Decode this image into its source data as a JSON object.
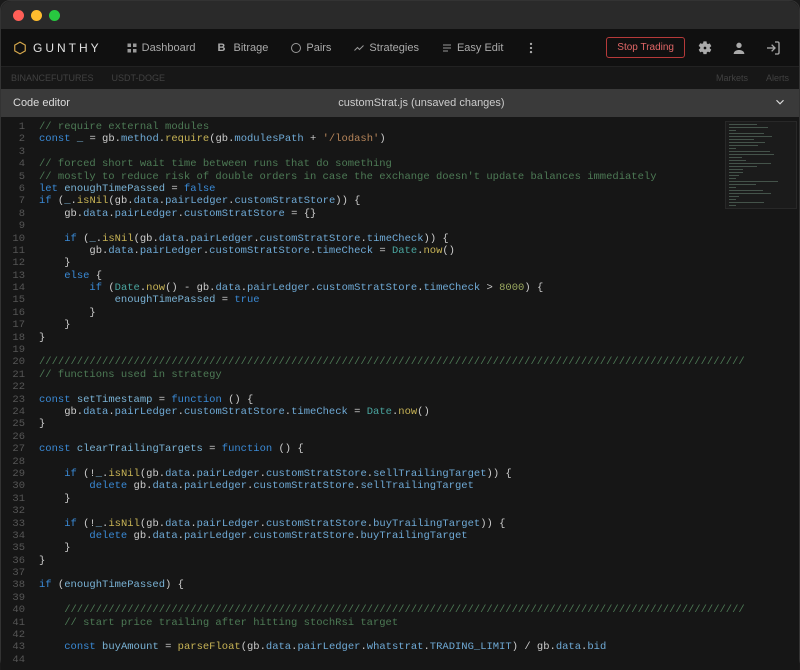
{
  "brand": "GUNTHY",
  "nav": {
    "dashboard": "Dashboard",
    "bitrage": "Bitrage",
    "pairs": "Pairs",
    "strategies": "Strategies",
    "easyedit": "Easy Edit"
  },
  "subbar": {
    "exchange": "BINANCEFUTURES",
    "pair": "USDT-DOGE",
    "markets": "Markets",
    "alerts": "Alerts"
  },
  "actions": {
    "stop": "Stop Trading"
  },
  "editor": {
    "title": "Code editor",
    "filename": "customStrat.js (unsaved changes)"
  },
  "code": {
    "lines": [
      {
        "n": 1,
        "t": "comment",
        "raw": "// require external modules"
      },
      {
        "n": 2,
        "t": "code",
        "raw": "const _ = gb.method.require(gb.modulesPath + '/lodash')"
      },
      {
        "n": 3,
        "t": "blank",
        "raw": ""
      },
      {
        "n": 4,
        "t": "comment",
        "raw": "// forced short wait time between runs that do something"
      },
      {
        "n": 5,
        "t": "comment",
        "raw": "// mostly to reduce risk of double orders in case the exchange doesn't update balances immediately"
      },
      {
        "n": 6,
        "t": "code",
        "raw": "let enoughTimePassed = false"
      },
      {
        "n": 7,
        "t": "code",
        "raw": "if (_.isNil(gb.data.pairLedger.customStratStore)) {"
      },
      {
        "n": 8,
        "t": "code",
        "raw": "    gb.data.pairLedger.customStratStore = {}"
      },
      {
        "n": 9,
        "t": "blank",
        "raw": ""
      },
      {
        "n": 10,
        "t": "code",
        "raw": "    if (_.isNil(gb.data.pairLedger.customStratStore.timeCheck)) {"
      },
      {
        "n": 11,
        "t": "code",
        "raw": "        gb.data.pairLedger.customStratStore.timeCheck = Date.now()"
      },
      {
        "n": 12,
        "t": "code",
        "raw": "    }"
      },
      {
        "n": 13,
        "t": "code",
        "raw": "    else {"
      },
      {
        "n": 14,
        "t": "code",
        "raw": "        if (Date.now() - gb.data.pairLedger.customStratStore.timeCheck > 8000) {"
      },
      {
        "n": 15,
        "t": "code",
        "raw": "            enoughTimePassed = true"
      },
      {
        "n": 16,
        "t": "code",
        "raw": "        }"
      },
      {
        "n": 17,
        "t": "code",
        "raw": "    }"
      },
      {
        "n": 18,
        "t": "code",
        "raw": "}"
      },
      {
        "n": 19,
        "t": "blank",
        "raw": ""
      },
      {
        "n": 20,
        "t": "comment",
        "raw": "////////////////////////////////////////////////////////////////////////////////////////////////////////////////"
      },
      {
        "n": 21,
        "t": "comment",
        "raw": "// functions used in strategy"
      },
      {
        "n": 22,
        "t": "blank",
        "raw": ""
      },
      {
        "n": 23,
        "t": "code",
        "raw": "const setTimestamp = function () {"
      },
      {
        "n": 24,
        "t": "code",
        "raw": "    gb.data.pairLedger.customStratStore.timeCheck = Date.now()"
      },
      {
        "n": 25,
        "t": "code",
        "raw": "}"
      },
      {
        "n": 26,
        "t": "blank",
        "raw": ""
      },
      {
        "n": 27,
        "t": "code",
        "raw": "const clearTrailingTargets = function () {"
      },
      {
        "n": 28,
        "t": "blank",
        "raw": ""
      },
      {
        "n": 29,
        "t": "code",
        "raw": "    if (!_.isNil(gb.data.pairLedger.customStratStore.sellTrailingTarget)) {"
      },
      {
        "n": 30,
        "t": "code",
        "raw": "        delete gb.data.pairLedger.customStratStore.sellTrailingTarget"
      },
      {
        "n": 31,
        "t": "code",
        "raw": "    }"
      },
      {
        "n": 32,
        "t": "blank",
        "raw": ""
      },
      {
        "n": 33,
        "t": "code",
        "raw": "    if (!_.isNil(gb.data.pairLedger.customStratStore.buyTrailingTarget)) {"
      },
      {
        "n": 34,
        "t": "code",
        "raw": "        delete gb.data.pairLedger.customStratStore.buyTrailingTarget"
      },
      {
        "n": 35,
        "t": "code",
        "raw": "    }"
      },
      {
        "n": 36,
        "t": "code",
        "raw": "}"
      },
      {
        "n": 37,
        "t": "blank",
        "raw": ""
      },
      {
        "n": 38,
        "t": "code",
        "raw": "if (enoughTimePassed) {"
      },
      {
        "n": 39,
        "t": "blank",
        "raw": ""
      },
      {
        "n": 40,
        "t": "comment",
        "raw": "    ////////////////////////////////////////////////////////////////////////////////////////////////////////////"
      },
      {
        "n": 41,
        "t": "comment",
        "raw": "    // start price trailing after hitting stochRsi target"
      },
      {
        "n": 42,
        "t": "blank",
        "raw": ""
      },
      {
        "n": 43,
        "t": "code",
        "raw": "    const buyAmount = parseFloat(gb.data.pairLedger.whatstrat.TRADING_LIMIT) / gb.data.bid"
      },
      {
        "n": 44,
        "t": "blank",
        "raw": ""
      }
    ]
  },
  "minimap": {
    "bars": [
      40,
      55,
      10,
      50,
      62,
      35,
      52,
      42,
      10,
      58,
      64,
      18,
      24,
      60,
      40,
      20,
      20,
      14,
      10,
      70,
      38,
      10,
      48,
      60,
      14,
      10,
      50,
      10,
      58,
      62,
      18,
      10,
      58,
      62,
      18,
      14,
      10,
      40,
      10,
      70,
      52,
      10,
      64
    ]
  }
}
